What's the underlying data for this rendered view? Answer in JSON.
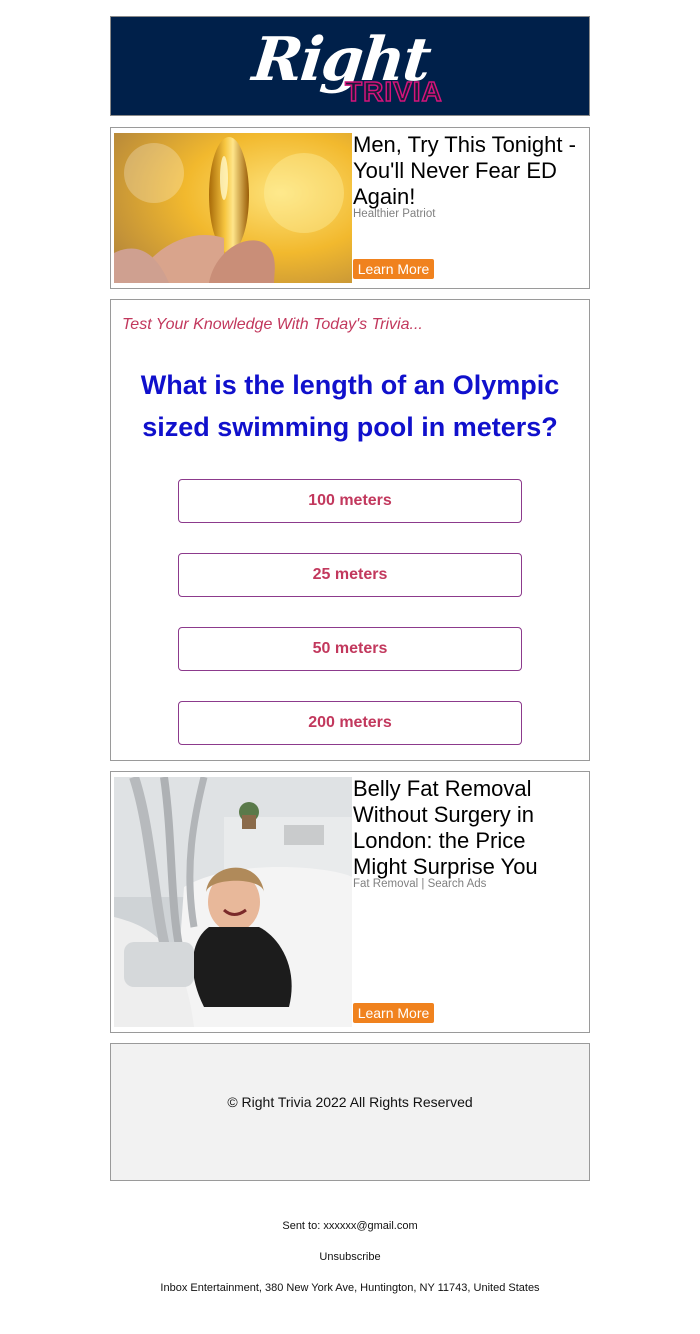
{
  "header": {
    "logo_word1": "Right",
    "logo_word2": "TRIVIA",
    "colors": {
      "background": "#00204a",
      "logo_main": "#ffffff",
      "logo_accent": "#d4147c"
    }
  },
  "ad_top": {
    "title": "Men, Try This Tonight - You'll Never Fear ED Again!",
    "source": "Healthier Patriot",
    "button": "Learn More",
    "image_icon": "capsule-photo"
  },
  "trivia": {
    "kicker": "Test Your Knowledge With Today's Trivia...",
    "question": "What is the length of an Olympic sized swimming pool in meters?",
    "answers": [
      "100 meters",
      "25 meters",
      "50 meters",
      "200 meters"
    ],
    "colors": {
      "question": "#1010cc",
      "answer_text": "#c2385d",
      "answer_border": "#8c3a8c"
    }
  },
  "ad_bottom": {
    "title": "Belly Fat Removal Without Surgery in London: the Price Might Surprise You",
    "source": "Fat Removal | Search Ads",
    "button": "Learn More",
    "image_icon": "clinic-treatment-photo"
  },
  "footer": {
    "copyright": "© Right Trivia 2022 All Rights Reserved",
    "sent_to": "Sent to: xxxxxx@gmail.com",
    "unsubscribe": "Unsubscribe",
    "address": "Inbox Entertainment, 380 New York Ave, Huntington, NY 11743, United States"
  },
  "accent_button_color": "#f0821e"
}
